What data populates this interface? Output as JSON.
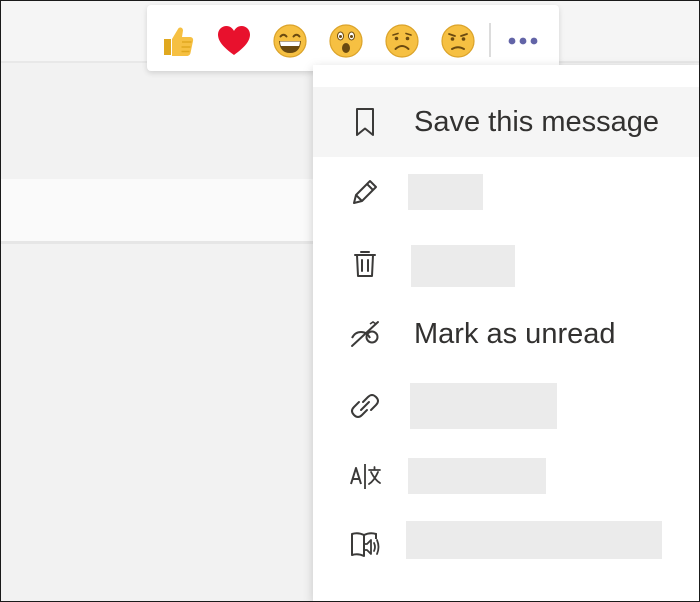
{
  "reactions": [
    {
      "name": "like",
      "icon": "thumbs-up-icon"
    },
    {
      "name": "heart",
      "icon": "heart-icon"
    },
    {
      "name": "laugh",
      "icon": "laughing-face-icon"
    },
    {
      "name": "surprised",
      "icon": "surprised-face-icon"
    },
    {
      "name": "sad",
      "icon": "sad-face-icon"
    },
    {
      "name": "angry",
      "icon": "angry-face-icon"
    }
  ],
  "more_options": {
    "icon": "more-options-icon",
    "color": "#6264a7"
  },
  "menu": {
    "items": [
      {
        "label": "Save this message",
        "icon": "bookmark-icon"
      },
      {
        "label": "",
        "icon": "pencil-icon"
      },
      {
        "label": "",
        "icon": "trash-icon"
      },
      {
        "label": "Mark as unread",
        "icon": "mark-unread-icon"
      },
      {
        "label": "",
        "icon": "link-icon"
      },
      {
        "label": "",
        "icon": "translate-icon"
      },
      {
        "label": "",
        "icon": "immersive-reader-icon"
      }
    ]
  },
  "colors": {
    "emoji_yellow": "#f6c042",
    "heart_red": "#e8112d",
    "text": "#323130",
    "accent": "#6264a7"
  }
}
